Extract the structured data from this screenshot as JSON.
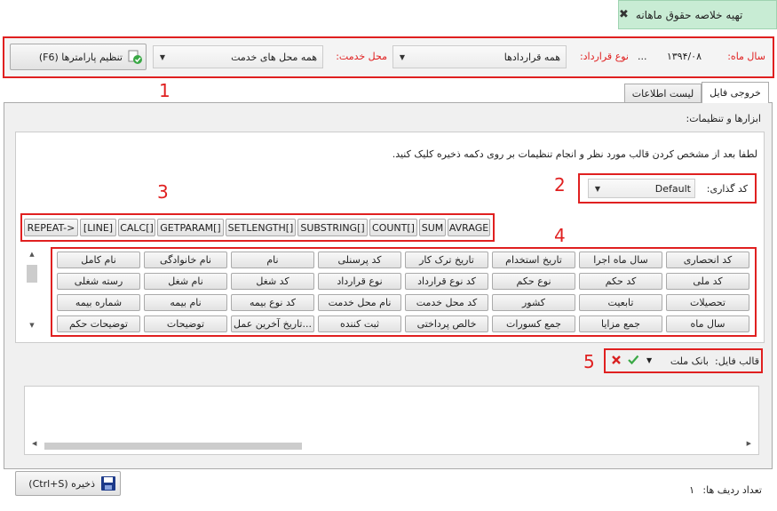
{
  "window_tab": {
    "title": "تهیه خلاصه حقوق ماهانه",
    "close_glyph": "✖"
  },
  "top_bar": {
    "year_month_label": "سال ماه:",
    "year_month_value": "۱۳۹۴/۰۸",
    "year_month_more": "...",
    "contract_type_label": "نوع قرارداد:",
    "contract_type_value": "همه قراردادها",
    "service_place_label": "محل خدمت:",
    "service_place_value": "همه محل های خدمت",
    "params_button": "تنظیم پارامترها (F6)"
  },
  "tabs": {
    "file_output": "خروجی فایل",
    "info_list": "لیست اطلاعات"
  },
  "panel": {
    "tools_label": "ابزارها و تنظیمات:",
    "instruction": "لطفا بعد از مشخص کردن قالب مورد نظر و انجام تنظیمات بر روی دکمه ذخیره کلیک کنید.",
    "encoding_label": "کد گذاری:",
    "encoding_value": "Default",
    "template_label": "قالب فایل:",
    "template_value": "بانک ملت"
  },
  "function_tags": [
    "AVRAGE",
    "SUM",
    "COUNT[]",
    "SUBSTRING[]",
    "SETLENGTH[]",
    "GETPARAM[]",
    "CALC[]",
    "[LINE]",
    "REPEAT->"
  ],
  "field_rows": [
    [
      "کد انحصاری",
      "سال ماه اجرا",
      "تاریخ استخدام",
      "تاریخ ترک کار",
      "کد پرسنلی",
      "نام",
      "نام خانوادگی",
      "نام کامل"
    ],
    [
      "کد ملی",
      "کد حکم",
      "نوع حکم",
      "کد نوع قرارداد",
      "نوع قرارداد",
      "کد شغل",
      "نام شغل",
      "رسته شغلی"
    ],
    [
      "تحصیلات",
      "تابعیت",
      "کشور",
      "کد محل خدمت",
      "نام محل خدمت",
      "کد نوع بیمه",
      "نام بیمه",
      "شماره بیمه"
    ],
    [
      "سال ماه",
      "جمع مزایا",
      "جمع کسورات",
      "خالص پرداختی",
      "ثبت کننده",
      "تاریخ آخرین عمل...",
      "توضیحات",
      "توضیحات حکم"
    ]
  ],
  "callouts": [
    "1",
    "2",
    "3",
    "4",
    "5"
  ],
  "footer": {
    "save_button": "ذخیره (Ctrl+S)",
    "row_count_label": "تعداد ردیف ها:",
    "row_count_value": "۱"
  },
  "colors": {
    "accent_green": "#c8ecd4",
    "callout_red": "#e02020"
  }
}
